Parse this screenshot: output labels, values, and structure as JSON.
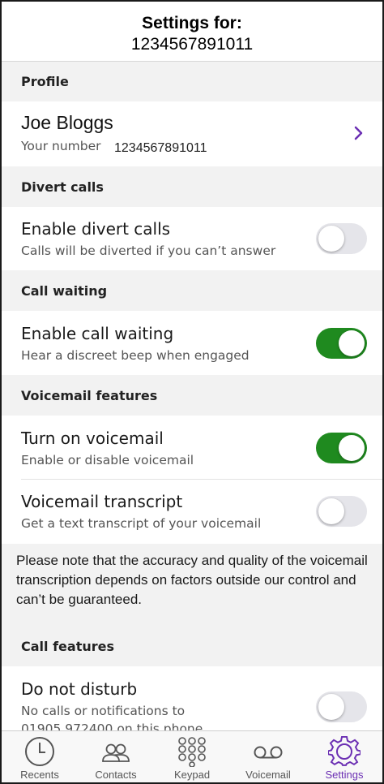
{
  "header": {
    "title": "Settings for:",
    "subtitle": "1234567891011"
  },
  "profile": {
    "section_title": "Profile",
    "name": "Joe Bloggs",
    "number_label": "Your number",
    "number_value": "1234567891011",
    "chevron_icon": "chevron-right-icon"
  },
  "divert_calls": {
    "section_title": "Divert calls",
    "label": "Enable divert calls",
    "description": "Calls will be diverted if you can’t answer",
    "enabled": false
  },
  "call_waiting": {
    "section_title": "Call waiting",
    "label": "Enable call waiting",
    "description": "Hear a discreet beep when engaged",
    "enabled": true
  },
  "voicemail_features": {
    "section_title": "Voicemail features",
    "voicemail": {
      "label": "Turn on voicemail",
      "description": "Enable or disable voicemail",
      "enabled": true
    },
    "transcript": {
      "label": "Voicemail transcript",
      "description": "Get a text transcript of your voicemail",
      "enabled": false
    },
    "note": "Please note that the accuracy and quality of the voicemail transcription depends on factors outside our control and can’t be guaranteed."
  },
  "call_features": {
    "section_title": "Call features",
    "do_not_disturb": {
      "label": "Do not disturb",
      "description_line1": "No calls or notifications to",
      "description_line2": "01905 972400 on this phone",
      "enabled": false
    }
  },
  "colors": {
    "accent": "#6b2fb3",
    "toggle_on": "#1f8a1f",
    "toggle_off": "#e5e5ea",
    "section_background": "#f2f2f2"
  },
  "tabbar": {
    "active": "Settings",
    "tabs": [
      {
        "label": "Recents",
        "icon": "clock-icon"
      },
      {
        "label": "Contacts",
        "icon": "contacts-icon"
      },
      {
        "label": "Keypad",
        "icon": "keypad-icon"
      },
      {
        "label": "Voicemail",
        "icon": "voicemail-icon"
      },
      {
        "label": "Settings",
        "icon": "gear-icon"
      }
    ]
  }
}
